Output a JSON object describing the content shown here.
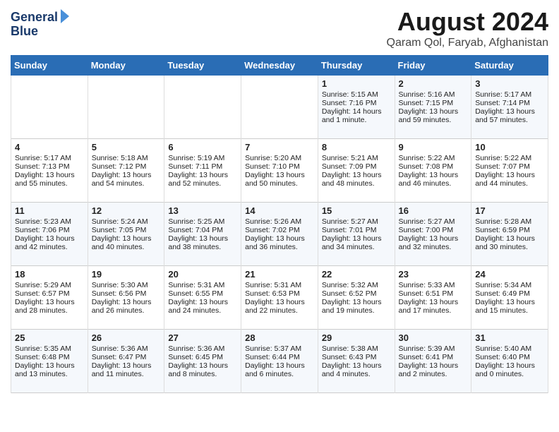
{
  "header": {
    "logo_line1": "General",
    "logo_line2": "Blue",
    "month_title": "August 2024",
    "subtitle": "Qaram Qol, Faryab, Afghanistan"
  },
  "weekdays": [
    "Sunday",
    "Monday",
    "Tuesday",
    "Wednesday",
    "Thursday",
    "Friday",
    "Saturday"
  ],
  "weeks": [
    [
      {
        "day": "",
        "content": ""
      },
      {
        "day": "",
        "content": ""
      },
      {
        "day": "",
        "content": ""
      },
      {
        "day": "",
        "content": ""
      },
      {
        "day": "1",
        "content": "Sunrise: 5:15 AM\nSunset: 7:16 PM\nDaylight: 14 hours\nand 1 minute."
      },
      {
        "day": "2",
        "content": "Sunrise: 5:16 AM\nSunset: 7:15 PM\nDaylight: 13 hours\nand 59 minutes."
      },
      {
        "day": "3",
        "content": "Sunrise: 5:17 AM\nSunset: 7:14 PM\nDaylight: 13 hours\nand 57 minutes."
      }
    ],
    [
      {
        "day": "4",
        "content": "Sunrise: 5:17 AM\nSunset: 7:13 PM\nDaylight: 13 hours\nand 55 minutes."
      },
      {
        "day": "5",
        "content": "Sunrise: 5:18 AM\nSunset: 7:12 PM\nDaylight: 13 hours\nand 54 minutes."
      },
      {
        "day": "6",
        "content": "Sunrise: 5:19 AM\nSunset: 7:11 PM\nDaylight: 13 hours\nand 52 minutes."
      },
      {
        "day": "7",
        "content": "Sunrise: 5:20 AM\nSunset: 7:10 PM\nDaylight: 13 hours\nand 50 minutes."
      },
      {
        "day": "8",
        "content": "Sunrise: 5:21 AM\nSunset: 7:09 PM\nDaylight: 13 hours\nand 48 minutes."
      },
      {
        "day": "9",
        "content": "Sunrise: 5:22 AM\nSunset: 7:08 PM\nDaylight: 13 hours\nand 46 minutes."
      },
      {
        "day": "10",
        "content": "Sunrise: 5:22 AM\nSunset: 7:07 PM\nDaylight: 13 hours\nand 44 minutes."
      }
    ],
    [
      {
        "day": "11",
        "content": "Sunrise: 5:23 AM\nSunset: 7:06 PM\nDaylight: 13 hours\nand 42 minutes."
      },
      {
        "day": "12",
        "content": "Sunrise: 5:24 AM\nSunset: 7:05 PM\nDaylight: 13 hours\nand 40 minutes."
      },
      {
        "day": "13",
        "content": "Sunrise: 5:25 AM\nSunset: 7:04 PM\nDaylight: 13 hours\nand 38 minutes."
      },
      {
        "day": "14",
        "content": "Sunrise: 5:26 AM\nSunset: 7:02 PM\nDaylight: 13 hours\nand 36 minutes."
      },
      {
        "day": "15",
        "content": "Sunrise: 5:27 AM\nSunset: 7:01 PM\nDaylight: 13 hours\nand 34 minutes."
      },
      {
        "day": "16",
        "content": "Sunrise: 5:27 AM\nSunset: 7:00 PM\nDaylight: 13 hours\nand 32 minutes."
      },
      {
        "day": "17",
        "content": "Sunrise: 5:28 AM\nSunset: 6:59 PM\nDaylight: 13 hours\nand 30 minutes."
      }
    ],
    [
      {
        "day": "18",
        "content": "Sunrise: 5:29 AM\nSunset: 6:57 PM\nDaylight: 13 hours\nand 28 minutes."
      },
      {
        "day": "19",
        "content": "Sunrise: 5:30 AM\nSunset: 6:56 PM\nDaylight: 13 hours\nand 26 minutes."
      },
      {
        "day": "20",
        "content": "Sunrise: 5:31 AM\nSunset: 6:55 PM\nDaylight: 13 hours\nand 24 minutes."
      },
      {
        "day": "21",
        "content": "Sunrise: 5:31 AM\nSunset: 6:53 PM\nDaylight: 13 hours\nand 22 minutes."
      },
      {
        "day": "22",
        "content": "Sunrise: 5:32 AM\nSunset: 6:52 PM\nDaylight: 13 hours\nand 19 minutes."
      },
      {
        "day": "23",
        "content": "Sunrise: 5:33 AM\nSunset: 6:51 PM\nDaylight: 13 hours\nand 17 minutes."
      },
      {
        "day": "24",
        "content": "Sunrise: 5:34 AM\nSunset: 6:49 PM\nDaylight: 13 hours\nand 15 minutes."
      }
    ],
    [
      {
        "day": "25",
        "content": "Sunrise: 5:35 AM\nSunset: 6:48 PM\nDaylight: 13 hours\nand 13 minutes."
      },
      {
        "day": "26",
        "content": "Sunrise: 5:36 AM\nSunset: 6:47 PM\nDaylight: 13 hours\nand 11 minutes."
      },
      {
        "day": "27",
        "content": "Sunrise: 5:36 AM\nSunset: 6:45 PM\nDaylight: 13 hours\nand 8 minutes."
      },
      {
        "day": "28",
        "content": "Sunrise: 5:37 AM\nSunset: 6:44 PM\nDaylight: 13 hours\nand 6 minutes."
      },
      {
        "day": "29",
        "content": "Sunrise: 5:38 AM\nSunset: 6:43 PM\nDaylight: 13 hours\nand 4 minutes."
      },
      {
        "day": "30",
        "content": "Sunrise: 5:39 AM\nSunset: 6:41 PM\nDaylight: 13 hours\nand 2 minutes."
      },
      {
        "day": "31",
        "content": "Sunrise: 5:40 AM\nSunset: 6:40 PM\nDaylight: 13 hours\nand 0 minutes."
      }
    ]
  ]
}
